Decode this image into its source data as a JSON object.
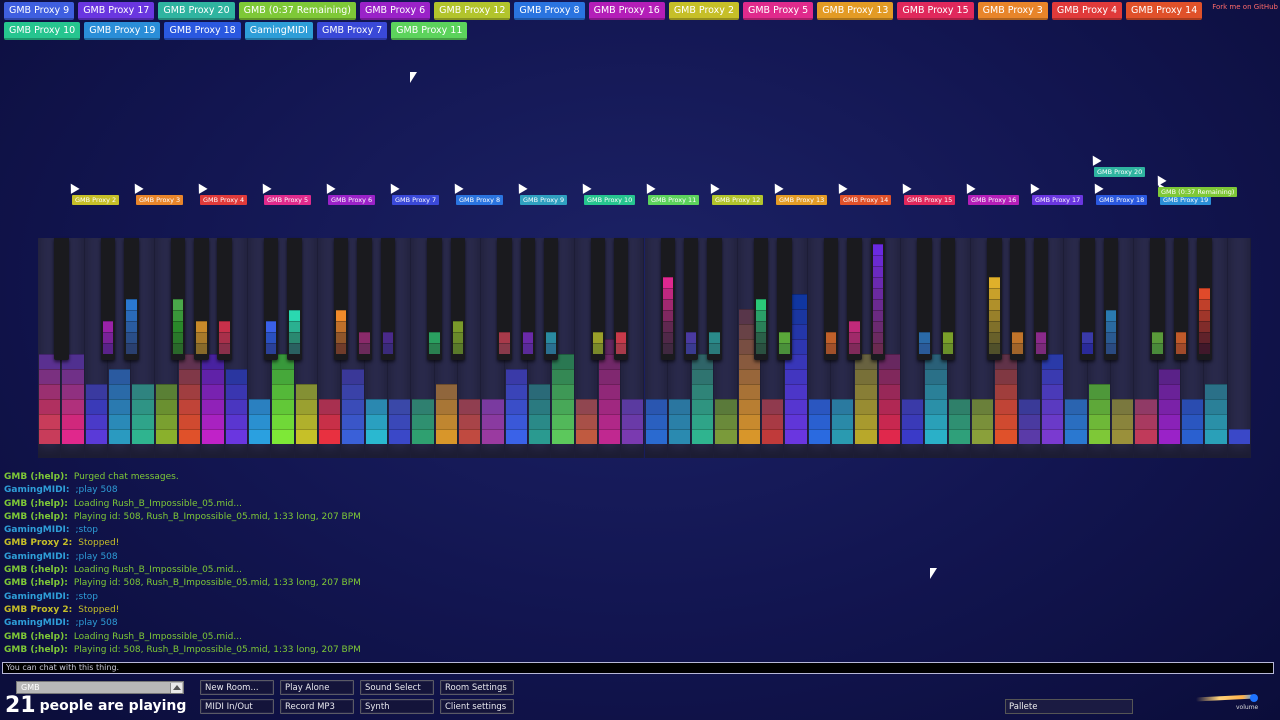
{
  "participants": [
    {
      "name": "GMB Proxy 9",
      "color": "#3f5fe0"
    },
    {
      "name": "GMB Proxy 17",
      "color": "#6a36e0"
    },
    {
      "name": "GMB Proxy 20",
      "color": "#2fb4a0"
    },
    {
      "name": "GMB (0:37 Remaining)",
      "color": "#7ec837"
    },
    {
      "name": "GMB Proxy 6",
      "color": "#9a22c8"
    },
    {
      "name": "GMB Proxy 12",
      "color": "#b2c42c"
    },
    {
      "name": "GMB Proxy 8",
      "color": "#2a74e0"
    },
    {
      "name": "GMB Proxy 16",
      "color": "#b41eb8"
    },
    {
      "name": "GMB Proxy 2",
      "color": "#c6bf28"
    },
    {
      "name": "GMB Proxy 5",
      "color": "#e02a8c"
    },
    {
      "name": "GMB Proxy 13",
      "color": "#e39b25"
    },
    {
      "name": "GMB Proxy 15",
      "color": "#e0285c"
    },
    {
      "name": "GMB Proxy 3",
      "color": "#e8852a"
    },
    {
      "name": "GMB Proxy 4",
      "color": "#e03a3a"
    },
    {
      "name": "GMB Proxy 14",
      "color": "#e0512a"
    },
    {
      "name": "GMB Proxy 10",
      "color": "#26c58f"
    },
    {
      "name": "GMB Proxy 19",
      "color": "#2a8ed8"
    },
    {
      "name": "GMB Proxy 18",
      "color": "#2a58e0"
    },
    {
      "name": "GamingMIDI",
      "color": "#2e9ed8"
    },
    {
      "name": "GMB Proxy 7",
      "color": "#3a49d8"
    },
    {
      "name": "GMB Proxy 11",
      "color": "#5cd35c"
    }
  ],
  "github_link": "Fork me on GitHub",
  "cursor_tags": [
    {
      "name": "GMB Proxy 2",
      "color": "#c6bf28"
    },
    {
      "name": "GMB Proxy 3",
      "color": "#e8852a"
    },
    {
      "name": "GMB Proxy 4",
      "color": "#e03a3a"
    },
    {
      "name": "GMB Proxy 5",
      "color": "#e02a8c"
    },
    {
      "name": "GMB Proxy 6",
      "color": "#9a22c8"
    },
    {
      "name": "GMB Proxy 7",
      "color": "#3a49d8"
    },
    {
      "name": "GMB Proxy 8",
      "color": "#2a74e0"
    },
    {
      "name": "GMB Proxy 9",
      "color": "#2fa0c0"
    },
    {
      "name": "GMB Proxy 10",
      "color": "#26c58f"
    },
    {
      "name": "GMB Proxy 11",
      "color": "#5cd35c"
    },
    {
      "name": "GMB Proxy 12",
      "color": "#b2c42c"
    },
    {
      "name": "GMB Proxy 13",
      "color": "#e39b25"
    },
    {
      "name": "GMB Proxy 14",
      "color": "#e0512a"
    },
    {
      "name": "GMB Proxy 15",
      "color": "#e0285c"
    },
    {
      "name": "GMB Proxy 16",
      "color": "#b41eb8"
    },
    {
      "name": "GMB Proxy 17",
      "color": "#6a36e0"
    },
    {
      "name": "GMB Proxy 18",
      "color": "#2a58e0"
    },
    {
      "name": "GMB Proxy 19",
      "color": "#2a8ed8"
    },
    {
      "name": "GMB Proxy 20",
      "color": "#2fb4a0"
    },
    {
      "name": "GMB (0:37 Remaining)",
      "color": "#7ec837"
    }
  ],
  "chat": [
    {
      "name": "GMB (;help):",
      "text": "Purged chat messages.",
      "color": "#7ec837"
    },
    {
      "name": "GamingMIDI:",
      "text": ";play 508",
      "color": "#2e9ed8"
    },
    {
      "name": "GMB (;help):",
      "text": "Loading Rush_B_Impossible_05.mid...",
      "color": "#7ec837"
    },
    {
      "name": "GMB (;help):",
      "text": "Playing id: 508, Rush_B_Impossible_05.mid, 1:33 long, 207 BPM",
      "color": "#7ec837"
    },
    {
      "name": "GamingMIDI:",
      "text": ";stop",
      "color": "#2e9ed8"
    },
    {
      "name": "GMB Proxy 2:",
      "text": "Stopped!",
      "color": "#c6bf28"
    },
    {
      "name": "GamingMIDI:",
      "text": ";play 508",
      "color": "#2e9ed8"
    },
    {
      "name": "GMB (;help):",
      "text": "Loading Rush_B_Impossible_05.mid...",
      "color": "#7ec837"
    },
    {
      "name": "GMB (;help):",
      "text": "Playing id: 508, Rush_B_Impossible_05.mid, 1:33 long, 207 BPM",
      "color": "#7ec837"
    },
    {
      "name": "GamingMIDI:",
      "text": ";stop",
      "color": "#2e9ed8"
    },
    {
      "name": "GMB Proxy 2:",
      "text": "Stopped!",
      "color": "#c6bf28"
    },
    {
      "name": "GamingMIDI:",
      "text": ";play 508",
      "color": "#2e9ed8"
    },
    {
      "name": "GMB (;help):",
      "text": "Loading Rush_B_Impossible_05.mid...",
      "color": "#7ec837"
    },
    {
      "name": "GMB (;help):",
      "text": "Playing id: 508, Rush_B_Impossible_05.mid, 1:33 long, 207 BPM",
      "color": "#7ec837"
    }
  ],
  "chat_input": {
    "placeholder": "You can chat with this thing."
  },
  "footer": {
    "room": "GMB",
    "player_count": "21",
    "player_text": "people are playing",
    "buttons": {
      "new_room": "New Room...",
      "play_alone": "Play Alone",
      "sound_select": "Sound Select",
      "room_settings": "Room Settings",
      "midi_in_out": "MIDI In/Out",
      "record_mp3": "Record MP3",
      "synth": "Synth",
      "client_settings": "Client settings"
    },
    "pallete": "Pallete",
    "volume_label": "volume",
    "volume_level": 0.95
  },
  "piano": {
    "white_key_count": 52,
    "white_notes": [
      {
        "blocks": [
          "#c83c5a",
          "#c83c5a",
          "#b03060",
          "#9a3070",
          "#7a3080",
          "#5a3090"
        ]
      },
      {
        "blocks": [
          "#e0288c",
          "#d0287c",
          "#b0307c",
          "#903080",
          "#703088",
          "#503090"
        ]
      },
      {
        "blocks": [
          "#5a3ad8",
          "#4a3ac8",
          "#3a3ab8",
          "#3a3aa0"
        ]
      },
      {
        "blocks": [
          "#2a9ac0",
          "#2a8ab8",
          "#2a7ab0",
          "#2a6aa8",
          "#2a5aa0"
        ]
      },
      {
        "blocks": [
          "#2fb48f",
          "#2fa48a",
          "#2f9485",
          "#2f8480"
        ]
      },
      {
        "blocks": [
          "#8ab02c",
          "#7aa030",
          "#6a9030",
          "#5a8035"
        ]
      },
      {
        "blocks": [
          "#e0512a",
          "#d04a30",
          "#c04438",
          "#a03e40",
          "#803848",
          "#603250"
        ]
      },
      {
        "blocks": [
          "#c022c8",
          "#a822c0",
          "#9022b8",
          "#7822b0",
          "#6022a8",
          "#4822a0"
        ]
      },
      {
        "blocks": [
          "#6a36e0",
          "#5a36d0",
          "#4a36c0",
          "#3a36b0",
          "#2a36a0"
        ]
      },
      {
        "blocks": [
          "#2aa0e0",
          "#2a90d0",
          "#2a80c0"
        ]
      },
      {
        "blocks": [
          "#7ee837",
          "#70d838",
          "#62c838",
          "#54b839",
          "#46a83a",
          "#38983b"
        ]
      },
      {
        "blocks": [
          "#c6c028",
          "#b0b02c",
          "#9aa030",
          "#849034"
        ]
      },
      {
        "blocks": [
          "#e83040",
          "#c83048",
          "#a83050"
        ]
      },
      {
        "blocks": [
          "#3a60d8",
          "#3a56c8",
          "#3a4cb8",
          "#3a42a8",
          "#3a3898"
        ]
      },
      {
        "blocks": [
          "#2ab8d0",
          "#2aa0c0",
          "#2a88b0"
        ]
      },
      {
        "blocks": [
          "#3a48c8",
          "#3a48b8",
          "#3a48a8"
        ]
      },
      {
        "blocks": [
          "#2fa070",
          "#2f9070",
          "#2f8070"
        ]
      },
      {
        "blocks": [
          "#d8962a",
          "#c08630",
          "#a87636",
          "#90663c"
        ]
      },
      {
        "blocks": [
          "#c04a40",
          "#a84448",
          "#903e50"
        ]
      },
      {
        "blocks": [
          "#9a3aa0",
          "#8a3aa0",
          "#7a3aa0"
        ]
      },
      {
        "blocks": [
          "#3a62e8",
          "#3a58d8",
          "#3a4ec8",
          "#3a44b8",
          "#3a3aa8"
        ]
      },
      {
        "blocks": [
          "#2a9a90",
          "#2a8a88",
          "#2a7a80",
          "#2a6a78"
        ]
      },
      {
        "blocks": [
          "#5cc85c",
          "#52b85a",
          "#48a858",
          "#3e9856",
          "#348854",
          "#2a7852"
        ]
      },
      {
        "blocks": [
          "#c05a40",
          "#a85048",
          "#904650"
        ]
      },
      {
        "blocks": [
          "#c02890",
          "#b02888",
          "#a02880",
          "#902878",
          "#802870",
          "#702868",
          "#602860"
        ]
      },
      {
        "blocks": [
          "#7a3ab0",
          "#6a3aa8",
          "#5a3aa0"
        ]
      },
      {
        "blocks": [
          "#2a6ad0",
          "#2a60c0",
          "#2a56b0"
        ]
      },
      {
        "blocks": [
          "#2a8ab0",
          "#2a80a8",
          "#2a76a0"
        ]
      },
      {
        "blocks": [
          "#2fb48f",
          "#2fa488",
          "#2f9480",
          "#2f8478",
          "#2f7470",
          "#2f6468"
        ]
      },
      {
        "blocks": [
          "#7a9a3a",
          "#6a8a3a",
          "#5a7a3a"
        ]
      },
      {
        "blocks": [
          "#d8962a",
          "#c88a2e",
          "#b87e32",
          "#a87236",
          "#98663a",
          "#885a3e",
          "#784e42",
          "#684246",
          "#58364a"
        ]
      },
      {
        "blocks": [
          "#c03a3a",
          "#a83a44",
          "#903a4e"
        ]
      },
      {
        "blocks": [
          "#6a36e0",
          "#6036d8",
          "#5636d0",
          "#4c36c8",
          "#4236c0",
          "#3836b8",
          "#2e36b0",
          "#2436a8",
          "#1a36a0",
          "#1036a0"
        ]
      },
      {
        "blocks": [
          "#2a6ae0",
          "#2a60d0",
          "#2a56c0"
        ]
      },
      {
        "blocks": [
          "#2a9ab0",
          "#2a8aa8",
          "#2a7aa0"
        ]
      },
      {
        "blocks": [
          "#b8a82a",
          "#a89a2e",
          "#988c32",
          "#887e36",
          "#787038",
          "#686240"
        ]
      },
      {
        "blocks": [
          "#e0284c",
          "#c82850",
          "#b02854",
          "#982858",
          "#80285c",
          "#682860"
        ]
      },
      {
        "blocks": [
          "#3a3ac8",
          "#3a3ab8",
          "#3a3aa8"
        ]
      },
      {
        "blocks": [
          "#2ab0c8",
          "#2aa0b8",
          "#2a90a8",
          "#2a8098",
          "#2a7088",
          "#2a6078"
        ]
      },
      {
        "blocks": [
          "#2fa07a",
          "#2f9072",
          "#2f806a"
        ]
      },
      {
        "blocks": [
          "#8aa03a",
          "#7a903a",
          "#6a803a"
        ]
      },
      {
        "blocks": [
          "#e0512a",
          "#d04a30",
          "#c04436",
          "#a03e3c",
          "#803842",
          "#603248"
        ]
      },
      {
        "blocks": [
          "#5a3aa8",
          "#4a3aa0",
          "#3a3a98"
        ]
      },
      {
        "blocks": [
          "#7a3ad0",
          "#6a3ac8",
          "#5a3ac0",
          "#4a3ab8",
          "#3a3ab0",
          "#2a3aa8"
        ]
      },
      {
        "blocks": [
          "#2a78d0",
          "#2a6ec0",
          "#2a64b0"
        ]
      },
      {
        "blocks": [
          "#7ec837",
          "#6eb838",
          "#5ea839",
          "#4e983a"
        ]
      },
      {
        "blocks": [
          "#9a903a",
          "#8a843c",
          "#7a783e"
        ]
      },
      {
        "blocks": [
          "#c03a5a",
          "#a83a60",
          "#903a66"
        ]
      },
      {
        "blocks": [
          "#9a22c8",
          "#8a22b8",
          "#7a22a8",
          "#6a2298",
          "#5a2288"
        ]
      },
      {
        "blocks": [
          "#2a60d0",
          "#2a56c0",
          "#2a4cb0"
        ]
      },
      {
        "blocks": [
          "#2aa0b8",
          "#2a90a8",
          "#2a8098",
          "#2a7088"
        ]
      },
      {
        "blocks": [
          "#3a48c8"
        ]
      }
    ],
    "black_notes": [
      {
        "blocks": []
      },
      {
        "blocks": [
          "#9a22a8",
          "#7a2298",
          "#5a2288"
        ]
      },
      {
        "blocks": [
          "#2a78d0",
          "#2a6ab8",
          "#2a5ca0",
          "#2a4e88",
          "#2a4070"
        ]
      },
      {
        "blocks": [
          "#4aa84a",
          "#3a983a",
          "#2a882a",
          "#2a782a",
          "#2a682a"
        ]
      },
      {
        "blocks": [
          "#c88a2a",
          "#a87a2a",
          "#886a2a"
        ]
      },
      {
        "blocks": [
          "#c8304a",
          "#a8304a",
          "#88304a"
        ]
      },
      {
        "blocks": [
          "#3a60e8",
          "#2a50c0",
          "#2a4098"
        ]
      },
      {
        "blocks": [
          "#2ad8b0",
          "#2ab090",
          "#2a8870",
          "#2a6060"
        ]
      },
      {
        "blocks": [
          "#f08a2a",
          "#c0702a",
          "#90562a",
          "#703c2a"
        ]
      },
      {
        "blocks": [
          "#8a2a6a",
          "#6a2a5a"
        ]
      },
      {
        "blocks": [
          "#4a2a8a",
          "#3a2a7a"
        ]
      },
      {
        "blocks": [
          "#2aa060",
          "#2a8050"
        ]
      },
      {
        "blocks": [
          "#7a9a2a",
          "#6a8a2a",
          "#5a7a2a"
        ]
      },
      {
        "blocks": [
          "#a83a4a",
          "#883a4a"
        ]
      },
      {
        "blocks": [
          "#6a2aa8",
          "#5a2a98"
        ]
      },
      {
        "blocks": [
          "#2a8aa0",
          "#2a7090"
        ]
      },
      {
        "blocks": [
          "#9aa02a",
          "#7a8a2a"
        ]
      },
      {
        "blocks": [
          "#c83a4a",
          "#a83a4a"
        ]
      },
      {
        "blocks": [
          "#e02890",
          "#c02880",
          "#a02870",
          "#802860",
          "#602850",
          "#502848",
          "#402840"
        ]
      },
      {
        "blocks": [
          "#4a3aa0",
          "#3a3a90"
        ]
      },
      {
        "blocks": [
          "#2a8a8a",
          "#2a7a7a"
        ]
      },
      {
        "blocks": [
          "#2ac878",
          "#2aa068",
          "#2a8058",
          "#2a6048",
          "#2a5040"
        ]
      },
      {
        "blocks": [
          "#5aa83a",
          "#4a903a"
        ]
      },
      {
        "blocks": [
          "#c0602a",
          "#a0502a"
        ]
      },
      {
        "blocks": [
          "#c02a7a",
          "#a02a6a",
          "#802a5a"
        ]
      },
      {
        "blocks": [
          "#6a2ae0",
          "#6a2ad0",
          "#6a2ac0",
          "#6a2ab0",
          "#6a2aa0",
          "#6a2a90",
          "#6a2a80",
          "#6a2a70",
          "#6a2a60",
          "#6a2a50"
        ]
      },
      {
        "blocks": [
          "#2a6aa8",
          "#2a5a98"
        ]
      },
      {
        "blocks": [
          "#7aa02a",
          "#6a902a"
        ]
      },
      {
        "blocks": [
          "#e0b02a",
          "#c8a02a",
          "#b0902a",
          "#98802a",
          "#80702a",
          "#68602a",
          "#50502a"
        ]
      },
      {
        "blocks": [
          "#c0742a",
          "#a0642a"
        ]
      },
      {
        "blocks": [
          "#8a2a8a",
          "#7a2a7a"
        ]
      },
      {
        "blocks": [
          "#3a3aa8",
          "#2a2a98"
        ]
      },
      {
        "blocks": [
          "#2a7ab0",
          "#2a6aa0",
          "#2a5a90",
          "#2a4a80"
        ]
      },
      {
        "blocks": [
          "#5a9a3a",
          "#4a8a3a"
        ]
      },
      {
        "blocks": [
          "#c05a2a",
          "#a04a2a"
        ]
      },
      {
        "blocks": [
          "#e04a2a",
          "#c0402a",
          "#a0362a",
          "#802c2a",
          "#60222a",
          "#40182a"
        ]
      },
      {
        "blocks": [
          "#7a2a8a",
          "#6a2a7a"
        ]
      },
      {
        "blocks": [
          "#3a4ab0",
          "#2a3aa0"
        ]
      },
      {
        "blocks": [
          "#2a9a70",
          "#2a8a60",
          "#2a7a50"
        ]
      },
      {
        "blocks": [
          "#a05a2a",
          "#804a2a",
          "#603a2a"
        ]
      },
      {
        "blocks": [
          "#8a2a5a",
          "#6a2a4a"
        ]
      },
      {
        "blocks": [
          "#5a3ab0",
          "#4a3aa0"
        ]
      }
    ]
  }
}
